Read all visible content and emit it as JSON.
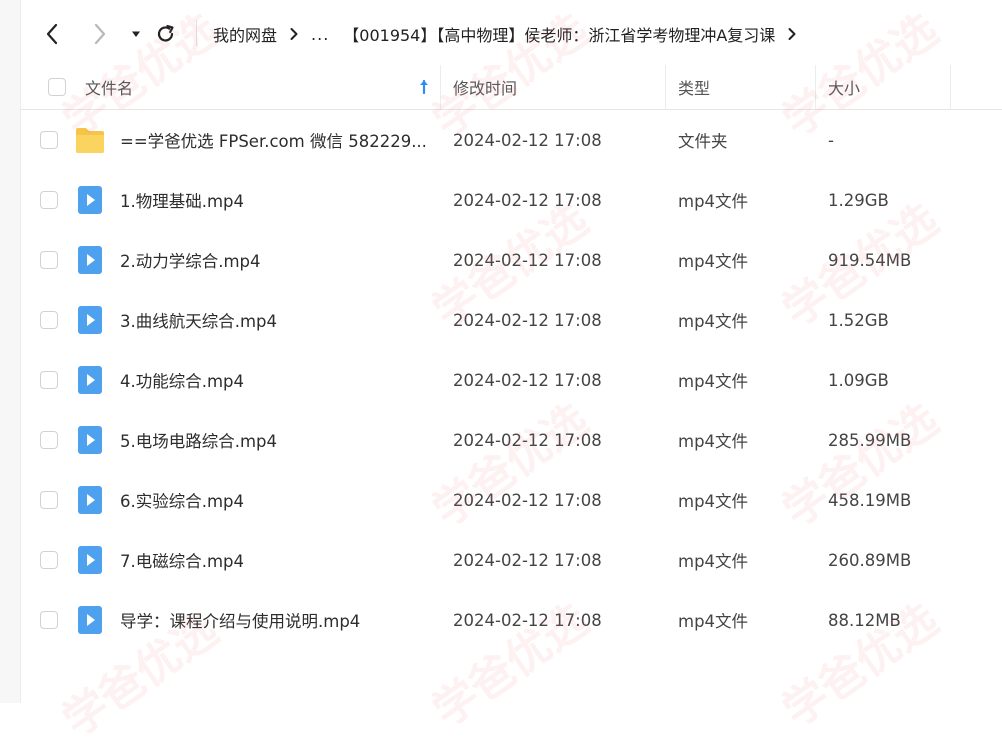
{
  "breadcrumb": {
    "root": "我的网盘",
    "ellipsis": "...",
    "current": "【001954】【高中物理】侯老师：浙江省学考物理冲A复习课"
  },
  "columns": {
    "name": "文件名",
    "modified": "修改时间",
    "type": "类型",
    "size": "大小"
  },
  "watermark": "学爸优选",
  "files": [
    {
      "name": "==学爸优选 FPSer.com 微信 582229...",
      "modified": "2024-02-12 17:08",
      "type": "文件夹",
      "size": "-",
      "icon": "folder-icon"
    },
    {
      "name": "1.物理基础.mp4",
      "modified": "2024-02-12 17:08",
      "type": "mp4文件",
      "size": "1.29GB",
      "icon": "video-file-icon"
    },
    {
      "name": "2.动力学综合.mp4",
      "modified": "2024-02-12 17:08",
      "type": "mp4文件",
      "size": "919.54MB",
      "icon": "video-file-icon"
    },
    {
      "name": "3.曲线航天综合.mp4",
      "modified": "2024-02-12 17:08",
      "type": "mp4文件",
      "size": "1.52GB",
      "icon": "video-file-icon"
    },
    {
      "name": "4.功能综合.mp4",
      "modified": "2024-02-12 17:08",
      "type": "mp4文件",
      "size": "1.09GB",
      "icon": "video-file-icon"
    },
    {
      "name": "5.电场电路综合.mp4",
      "modified": "2024-02-12 17:08",
      "type": "mp4文件",
      "size": "285.99MB",
      "icon": "video-file-icon"
    },
    {
      "name": "6.实验综合.mp4",
      "modified": "2024-02-12 17:08",
      "type": "mp4文件",
      "size": "458.19MB",
      "icon": "video-file-icon"
    },
    {
      "name": "7.电磁综合.mp4",
      "modified": "2024-02-12 17:08",
      "type": "mp4文件",
      "size": "260.89MB",
      "icon": "video-file-icon"
    },
    {
      "name": "导学：课程介绍与使用说明.mp4",
      "modified": "2024-02-12 17:08",
      "type": "mp4文件",
      "size": "88.12MB",
      "icon": "video-file-icon"
    }
  ],
  "colors": {
    "folder": "#f7c44a",
    "video": "#4ea1ee",
    "sort_arrow": "#2f8cf0"
  }
}
